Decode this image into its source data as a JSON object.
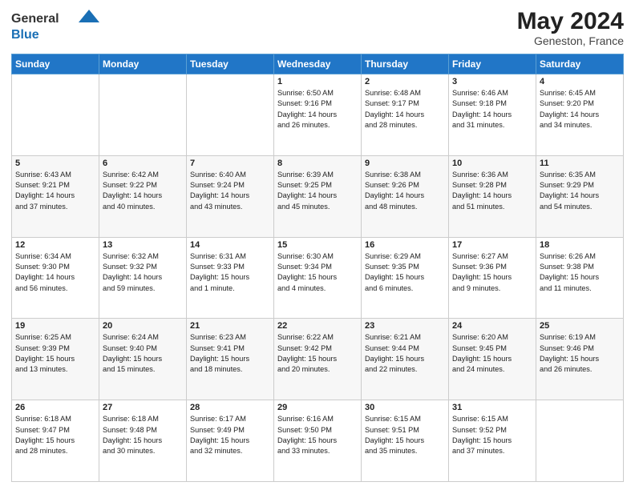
{
  "header": {
    "logo_general": "General",
    "logo_blue": "Blue",
    "month_year": "May 2024",
    "location": "Geneston, France"
  },
  "days_of_week": [
    "Sunday",
    "Monday",
    "Tuesday",
    "Wednesday",
    "Thursday",
    "Friday",
    "Saturday"
  ],
  "weeks": [
    [
      {
        "day": "",
        "content": ""
      },
      {
        "day": "",
        "content": ""
      },
      {
        "day": "",
        "content": ""
      },
      {
        "day": "1",
        "content": "Sunrise: 6:50 AM\nSunset: 9:16 PM\nDaylight: 14 hours\nand 26 minutes."
      },
      {
        "day": "2",
        "content": "Sunrise: 6:48 AM\nSunset: 9:17 PM\nDaylight: 14 hours\nand 28 minutes."
      },
      {
        "day": "3",
        "content": "Sunrise: 6:46 AM\nSunset: 9:18 PM\nDaylight: 14 hours\nand 31 minutes."
      },
      {
        "day": "4",
        "content": "Sunrise: 6:45 AM\nSunset: 9:20 PM\nDaylight: 14 hours\nand 34 minutes."
      }
    ],
    [
      {
        "day": "5",
        "content": "Sunrise: 6:43 AM\nSunset: 9:21 PM\nDaylight: 14 hours\nand 37 minutes."
      },
      {
        "day": "6",
        "content": "Sunrise: 6:42 AM\nSunset: 9:22 PM\nDaylight: 14 hours\nand 40 minutes."
      },
      {
        "day": "7",
        "content": "Sunrise: 6:40 AM\nSunset: 9:24 PM\nDaylight: 14 hours\nand 43 minutes."
      },
      {
        "day": "8",
        "content": "Sunrise: 6:39 AM\nSunset: 9:25 PM\nDaylight: 14 hours\nand 45 minutes."
      },
      {
        "day": "9",
        "content": "Sunrise: 6:38 AM\nSunset: 9:26 PM\nDaylight: 14 hours\nand 48 minutes."
      },
      {
        "day": "10",
        "content": "Sunrise: 6:36 AM\nSunset: 9:28 PM\nDaylight: 14 hours\nand 51 minutes."
      },
      {
        "day": "11",
        "content": "Sunrise: 6:35 AM\nSunset: 9:29 PM\nDaylight: 14 hours\nand 54 minutes."
      }
    ],
    [
      {
        "day": "12",
        "content": "Sunrise: 6:34 AM\nSunset: 9:30 PM\nDaylight: 14 hours\nand 56 minutes."
      },
      {
        "day": "13",
        "content": "Sunrise: 6:32 AM\nSunset: 9:32 PM\nDaylight: 14 hours\nand 59 minutes."
      },
      {
        "day": "14",
        "content": "Sunrise: 6:31 AM\nSunset: 9:33 PM\nDaylight: 15 hours\nand 1 minute."
      },
      {
        "day": "15",
        "content": "Sunrise: 6:30 AM\nSunset: 9:34 PM\nDaylight: 15 hours\nand 4 minutes."
      },
      {
        "day": "16",
        "content": "Sunrise: 6:29 AM\nSunset: 9:35 PM\nDaylight: 15 hours\nand 6 minutes."
      },
      {
        "day": "17",
        "content": "Sunrise: 6:27 AM\nSunset: 9:36 PM\nDaylight: 15 hours\nand 9 minutes."
      },
      {
        "day": "18",
        "content": "Sunrise: 6:26 AM\nSunset: 9:38 PM\nDaylight: 15 hours\nand 11 minutes."
      }
    ],
    [
      {
        "day": "19",
        "content": "Sunrise: 6:25 AM\nSunset: 9:39 PM\nDaylight: 15 hours\nand 13 minutes."
      },
      {
        "day": "20",
        "content": "Sunrise: 6:24 AM\nSunset: 9:40 PM\nDaylight: 15 hours\nand 15 minutes."
      },
      {
        "day": "21",
        "content": "Sunrise: 6:23 AM\nSunset: 9:41 PM\nDaylight: 15 hours\nand 18 minutes."
      },
      {
        "day": "22",
        "content": "Sunrise: 6:22 AM\nSunset: 9:42 PM\nDaylight: 15 hours\nand 20 minutes."
      },
      {
        "day": "23",
        "content": "Sunrise: 6:21 AM\nSunset: 9:44 PM\nDaylight: 15 hours\nand 22 minutes."
      },
      {
        "day": "24",
        "content": "Sunrise: 6:20 AM\nSunset: 9:45 PM\nDaylight: 15 hours\nand 24 minutes."
      },
      {
        "day": "25",
        "content": "Sunrise: 6:19 AM\nSunset: 9:46 PM\nDaylight: 15 hours\nand 26 minutes."
      }
    ],
    [
      {
        "day": "26",
        "content": "Sunrise: 6:18 AM\nSunset: 9:47 PM\nDaylight: 15 hours\nand 28 minutes."
      },
      {
        "day": "27",
        "content": "Sunrise: 6:18 AM\nSunset: 9:48 PM\nDaylight: 15 hours\nand 30 minutes."
      },
      {
        "day": "28",
        "content": "Sunrise: 6:17 AM\nSunset: 9:49 PM\nDaylight: 15 hours\nand 32 minutes."
      },
      {
        "day": "29",
        "content": "Sunrise: 6:16 AM\nSunset: 9:50 PM\nDaylight: 15 hours\nand 33 minutes."
      },
      {
        "day": "30",
        "content": "Sunrise: 6:15 AM\nSunset: 9:51 PM\nDaylight: 15 hours\nand 35 minutes."
      },
      {
        "day": "31",
        "content": "Sunrise: 6:15 AM\nSunset: 9:52 PM\nDaylight: 15 hours\nand 37 minutes."
      },
      {
        "day": "",
        "content": ""
      }
    ]
  ]
}
